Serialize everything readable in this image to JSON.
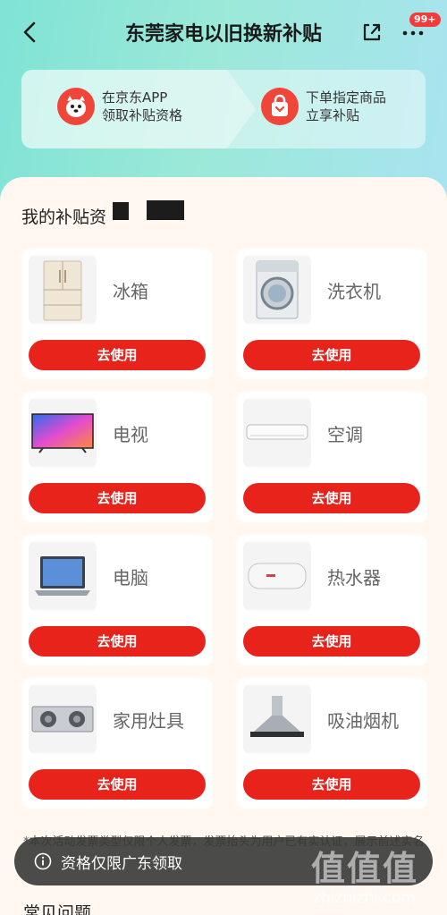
{
  "header": {
    "title": "东莞家电以旧换新补贴",
    "badge": "99+"
  },
  "steps": [
    {
      "line1": "在京东APP",
      "line2": "领取补贴资格"
    },
    {
      "line1": "下单指定商品",
      "line2": "立享补贴"
    }
  ],
  "section": {
    "title": "我的补贴资"
  },
  "categories": [
    {
      "name": "冰箱",
      "button": "去使用",
      "icon": "fridge-icon"
    },
    {
      "name": "洗衣机",
      "button": "去使用",
      "icon": "washing-machine-icon"
    },
    {
      "name": "电视",
      "button": "去使用",
      "icon": "tv-icon"
    },
    {
      "name": "空调",
      "button": "去使用",
      "icon": "air-conditioner-icon"
    },
    {
      "name": "电脑",
      "button": "去使用",
      "icon": "laptop-icon"
    },
    {
      "name": "热水器",
      "button": "去使用",
      "icon": "water-heater-icon"
    },
    {
      "name": "家用灶具",
      "button": "去使用",
      "icon": "gas-stove-icon"
    },
    {
      "name": "吸油烟机",
      "button": "去使用",
      "icon": "range-hood-icon"
    }
  ],
  "notice": "*本次活动发票类型仅限个人发票，发票抬头为用户已有实认证，展示前述实名用户即",
  "toast": {
    "text": "资格仅限广东领取"
  },
  "faq": {
    "title": "常见问题"
  },
  "watermark": {
    "logo": "值值值",
    "url": "zhizhizhi.com"
  },
  "colors": {
    "accent": "#e8231c",
    "header_gradient_start": "#7fe3d6",
    "header_gradient_end": "#a8e4f0"
  }
}
